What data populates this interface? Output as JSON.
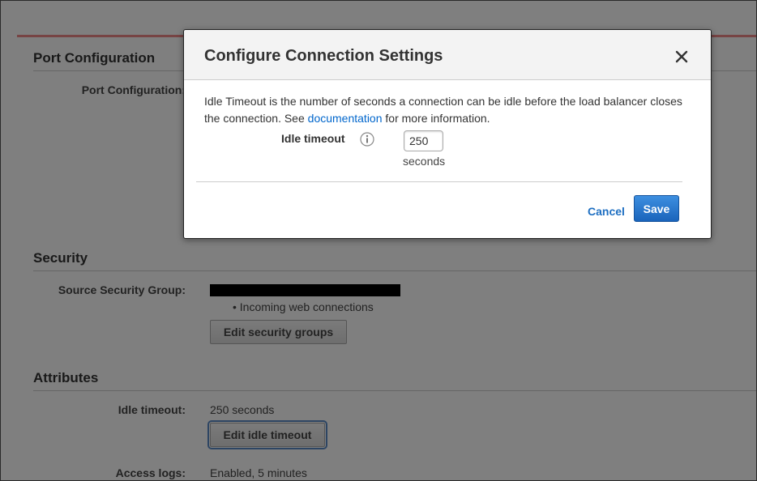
{
  "background": {
    "port_section": {
      "title": "Port Configuration",
      "label": "Port Configuration:"
    },
    "security_section": {
      "title": "Security",
      "source_group_label": "Source Security Group:",
      "incoming_note": "• Incoming web connections",
      "edit_button": "Edit security groups"
    },
    "attributes_section": {
      "title": "Attributes",
      "idle_label": "Idle timeout:",
      "idle_value": "250 seconds",
      "edit_idle_button": "Edit idle timeout",
      "access_logs_label": "Access logs:",
      "access_logs_value": "Enabled, 5 minutes"
    }
  },
  "modal": {
    "title": "Configure Connection Settings",
    "close_icon": "close-icon",
    "description_before": "Idle Timeout is the number of seconds a connection can be idle before the load balancer closes the connection. See ",
    "description_link": "documentation",
    "description_after": " for more information.",
    "field_label": "Idle timeout",
    "info_icon": "info-icon",
    "timeout_value": "250",
    "unit": "seconds",
    "cancel_label": "Cancel",
    "save_label": "Save"
  },
  "colors": {
    "primary_button": "#1a64bb",
    "link": "#0066cc",
    "overlay": "#7f7f7f"
  }
}
